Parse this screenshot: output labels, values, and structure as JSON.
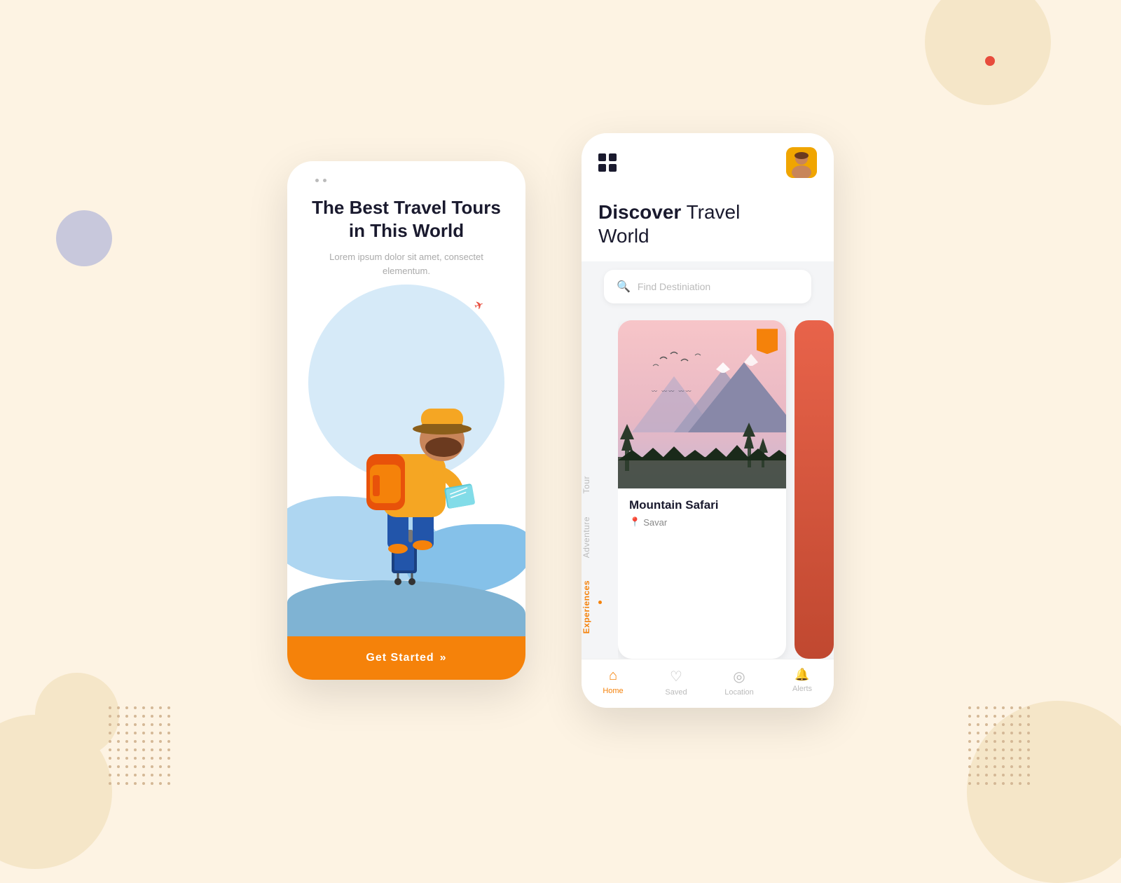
{
  "background": {
    "color": "#fdf3e3"
  },
  "phone1": {
    "title": "The Best Travel Tours in This World",
    "subtitle": "Lorem ipsum dolor sit amet, consectet elementum.",
    "button_label": "Get Started",
    "button_arrows": "»"
  },
  "phone2": {
    "header": {
      "grid_icon_label": "menu",
      "avatar_alt": "user avatar"
    },
    "title_bold": "Discover",
    "title_normal": " Travel\nWorld",
    "search": {
      "placeholder": "Find Destiniation"
    },
    "tabs": [
      {
        "label": "Tour",
        "active": false
      },
      {
        "label": "Adventure",
        "active": false
      },
      {
        "label": "Experiences",
        "active": true
      }
    ],
    "card": {
      "name": "Mountain Safari",
      "location": "Savar",
      "bookmarked": true
    },
    "bottom_nav": [
      {
        "label": "Home",
        "active": true,
        "icon": "⌂"
      },
      {
        "label": "Saved",
        "active": false,
        "icon": "♡"
      },
      {
        "label": "Location",
        "active": false,
        "icon": "◎"
      },
      {
        "label": "Alerts",
        "active": false,
        "icon": "🔔"
      }
    ]
  }
}
